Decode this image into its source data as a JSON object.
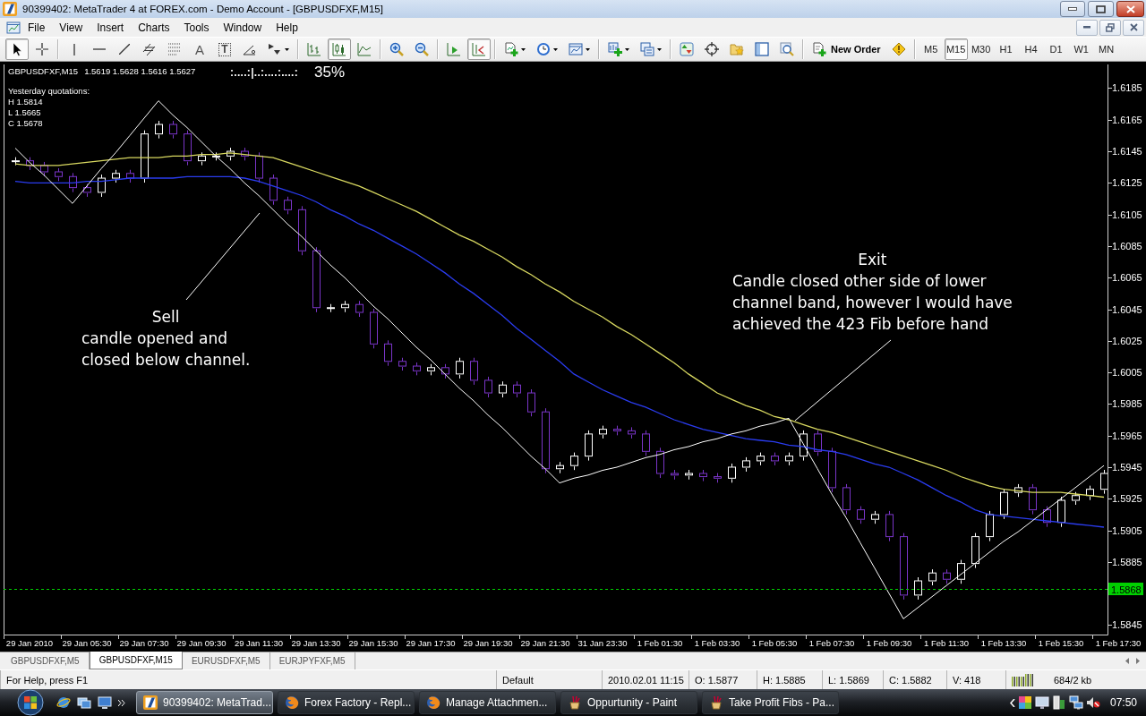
{
  "window": {
    "title": "90399402: MetaTrader 4 at FOREX.com - Demo Account - [GBPUSDFXF,M15]"
  },
  "menu": [
    "File",
    "View",
    "Insert",
    "Charts",
    "Tools",
    "Window",
    "Help"
  ],
  "toolbar": {
    "groups": [
      [
        {
          "kind": "icon",
          "pressed": true
        },
        {
          "kind": "icon",
          "pressed": false
        }
      ],
      [
        {
          "kind": "icon",
          "pressed": false
        },
        {
          "kind": "icon",
          "pressed": false
        },
        {
          "kind": "icon",
          "pressed": false
        },
        {
          "kind": "icon",
          "pressed": false
        },
        {
          "kind": "icon",
          "pressed": false
        },
        {
          "kind": "glyph",
          "label": "A",
          "pressed": false
        },
        {
          "kind": "glyph",
          "label": "T",
          "pressed": false
        },
        {
          "kind": "icon",
          "pressed": false
        },
        {
          "kind": "dropdown",
          "pressed": false
        }
      ],
      [
        {
          "kind": "icon",
          "pressed": false
        },
        {
          "kind": "icon",
          "pressed": true
        },
        {
          "kind": "icon",
          "pressed": false
        }
      ],
      [
        {
          "kind": "icon",
          "pressed": false
        },
        {
          "kind": "icon",
          "pressed": false
        }
      ],
      [
        {
          "kind": "icon",
          "pressed": false
        },
        {
          "kind": "icon",
          "pressed": true
        }
      ],
      [
        {
          "kind": "dropdown",
          "pressed": false
        },
        {
          "kind": "dropdown",
          "pressed": false
        },
        {
          "kind": "dropdown",
          "pressed": false
        }
      ],
      [
        {
          "kind": "dropdown",
          "pressed": false
        },
        {
          "kind": "dropdown",
          "pressed": false
        }
      ],
      [
        {
          "kind": "icon",
          "pressed": false
        },
        {
          "kind": "icon",
          "pressed": false
        },
        {
          "kind": "icon",
          "pressed": false
        },
        {
          "kind": "icon",
          "pressed": false
        },
        {
          "kind": "icon",
          "pressed": false
        }
      ],
      [
        {
          "kind": "labeled",
          "label": "New Order",
          "pressed": false
        },
        {
          "kind": "icon",
          "pressed": false
        }
      ]
    ],
    "periods": [
      {
        "label": "M5",
        "selected": false
      },
      {
        "label": "M15",
        "selected": true
      },
      {
        "label": "M30",
        "selected": false
      },
      {
        "label": "H1",
        "selected": false
      },
      {
        "label": "H4",
        "selected": false
      },
      {
        "label": "D1",
        "selected": false
      },
      {
        "label": "W1",
        "selected": false
      },
      {
        "label": "MN",
        "selected": false
      }
    ]
  },
  "chart": {
    "symbol": "GBPUSDFXF,M15",
    "ohlc": "1.5619 1.5628 1.5616 1.5627",
    "timer": {
      "text": ":....:|..:....:....:",
      "percent": "35%"
    },
    "yesterday": {
      "title": "Yesterday quotations:",
      "lines": [
        "H 1.5814",
        "L 1.5665",
        "C 1.5678"
      ]
    },
    "chart_data": {
      "type": "line",
      "categories": [
        null,
        "29 Jan 2010",
        null,
        null,
        null,
        "29 Jan 05:30",
        null,
        null,
        null,
        "29 Jan 07:30",
        null,
        null,
        null,
        "29 Jan 09:30",
        null,
        null,
        null,
        "29 Jan 11:30",
        null,
        null,
        null,
        "29 Jan 13:30",
        null,
        null,
        null,
        "29 Jan 15:30",
        null,
        null,
        null,
        "29 Jan 17:30",
        null,
        null,
        null,
        "29 Jan 19:30",
        null,
        null,
        null,
        "29 Jan 21:30",
        null,
        null,
        null,
        "31 Jan 23:30",
        null,
        null,
        null,
        "1 Feb 01:30",
        null,
        null,
        null,
        "1 Feb 03:30",
        null,
        null,
        null,
        "1 Feb 05:30",
        null,
        null,
        null,
        "1 Feb 07:30",
        null,
        null,
        null,
        "1 Feb 09:30",
        null,
        null,
        null,
        "1 Feb 11:30",
        null,
        null,
        null,
        "1 Feb 13:30",
        null,
        null,
        null,
        "1 Feb 15:30",
        null,
        null,
        null,
        "1 Feb 17:30"
      ],
      "ylim": [
        1.5839,
        1.62
      ],
      "yticks": [
        1.5845,
        1.5885,
        1.5905,
        1.5925,
        1.5945,
        1.5965,
        1.5985,
        1.6005,
        1.6025,
        1.6045,
        1.6065,
        1.6085,
        1.6105,
        1.6125,
        1.6145,
        1.6165,
        1.6185
      ],
      "series": [
        {
          "color": "#d8d860",
          "values": [
            1.6137,
            1.6136,
            1.6136,
            1.6136,
            1.6137,
            1.6138,
            1.6139,
            1.614,
            1.6141,
            1.6141,
            1.6141,
            1.6142,
            1.6142,
            1.6143,
            1.6143,
            1.6144,
            1.6143,
            1.6142,
            1.6141,
            1.6138,
            1.6135,
            1.6132,
            1.6129,
            1.6126,
            1.6123,
            1.6119,
            1.6115,
            1.6111,
            1.6107,
            1.6102,
            1.6097,
            1.6092,
            1.6088,
            1.6083,
            1.6078,
            1.6072,
            1.6067,
            1.6061,
            1.6056,
            1.605,
            1.6045,
            1.604,
            1.6034,
            1.6029,
            1.6023,
            1.6017,
            1.6011,
            1.6004,
            1.5998,
            1.5992,
            1.5988,
            1.5984,
            1.5981,
            1.5977,
            1.5975,
            1.5972,
            1.5969,
            1.5967,
            1.5964,
            1.5961,
            1.5958,
            1.5955,
            1.5952,
            1.5949,
            1.5946,
            1.5943,
            1.5939,
            1.5936,
            1.5933,
            1.5931,
            1.593,
            1.5929,
            1.5929,
            1.5929,
            1.5928,
            1.5927,
            1.5926,
            null
          ]
        },
        {
          "color": "#2a3cf0",
          "values": [
            1.6126,
            1.6125,
            1.6125,
            1.6125,
            1.6125,
            1.6126,
            1.6126,
            1.6127,
            1.6128,
            1.6128,
            1.6128,
            1.6128,
            1.6129,
            1.6129,
            1.6129,
            1.6129,
            1.6128,
            1.6126,
            1.6123,
            1.612,
            1.6117,
            1.6113,
            1.6108,
            1.6104,
            1.6099,
            1.6095,
            1.609,
            1.6085,
            1.608,
            1.6074,
            1.6068,
            1.6061,
            1.6055,
            1.6048,
            1.6041,
            1.6033,
            1.6026,
            1.6019,
            1.6012,
            1.6004,
            1.5999,
            1.5994,
            1.599,
            1.5986,
            1.5983,
            1.5979,
            1.5975,
            1.5972,
            1.5969,
            1.5967,
            1.5965,
            1.5963,
            1.5962,
            1.5961,
            1.5959,
            1.5958,
            1.5956,
            1.5955,
            1.5953,
            1.595,
            1.5947,
            1.5945,
            1.5941,
            1.5937,
            1.5932,
            1.5927,
            1.5923,
            1.5918,
            1.5915,
            1.5914,
            1.5913,
            1.5912,
            1.5911,
            1.591,
            1.5909,
            1.5908,
            1.5907,
            null
          ]
        },
        {
          "color": "#ffffff",
          "values": [
            1.6147,
            1.6138,
            1.613,
            1.6121,
            1.6112,
            1.6123,
            1.6134,
            1.6144,
            1.6155,
            1.6166,
            1.6177,
            1.6168,
            1.616,
            1.6151,
            1.6142,
            1.6134,
            1.6125,
            1.6117,
            1.6108,
            1.6099,
            1.6091,
            1.6082,
            1.6073,
            1.6065,
            1.6056,
            1.6047,
            1.6039,
            1.603,
            1.6021,
            1.6013,
            1.6004,
            1.5995,
            1.5987,
            1.5978,
            1.597,
            1.5961,
            1.5952,
            1.5944,
            1.5935,
            1.5938,
            1.594,
            1.5943,
            1.5945,
            1.5948,
            1.5951,
            1.5953,
            1.5956,
            1.5958,
            1.5961,
            1.5963,
            1.5966,
            1.5968,
            1.5971,
            1.5973,
            1.5976,
            1.596,
            1.5944,
            1.5928,
            1.5913,
            1.5897,
            1.5881,
            1.5865,
            1.5849,
            1.5856,
            1.5863,
            1.587,
            1.5877,
            1.5884,
            1.5891,
            1.5898,
            1.5904,
            1.5911,
            1.5918,
            1.5925,
            1.5932,
            1.5939,
            1.5946,
            null
          ]
        }
      ],
      "annotations": [
        "Sell\ncandle opened and\nclosed below channel.",
        "Exit\nCandle closed other side of lower\nchannel band, however I would have\nachieved the 423 Fib before hand"
      ],
      "ref_lines": [
        {
          "axis": "y",
          "value": 1.5868,
          "label": "1.5868",
          "color": "#00d000"
        }
      ]
    }
  },
  "chart_tabs": [
    {
      "label": "GBPUSDFXF,M5",
      "selected": false
    },
    {
      "label": "GBPUSDFXF,M15",
      "selected": true
    },
    {
      "label": "EURUSDFXF,M5",
      "selected": false
    },
    {
      "label": "EURJPYFXF,M5",
      "selected": false
    }
  ],
  "status_bar": {
    "help": "For Help, press F1",
    "profile": "Default",
    "time": "2010.02.01 11:15",
    "open": "O: 1.5877",
    "high": "H: 1.5885",
    "low": "L: 1.5869",
    "close": "C: 1.5882",
    "volume": "V: 418",
    "traffic": "684/2 kb"
  },
  "taskbar": {
    "tasks": [
      {
        "kind": "app",
        "label": "90399402: MetaTrad...",
        "selected": true
      },
      {
        "kind": "browser",
        "label": "Forex Factory - Repl...",
        "selected": false
      },
      {
        "kind": "browser",
        "label": "Manage Attachmen...",
        "selected": false
      },
      {
        "kind": "paint",
        "label": "Oppurtunity - Paint",
        "selected": false
      },
      {
        "kind": "paint",
        "label": "Take Profit Fibs - Pa...",
        "selected": false
      }
    ],
    "clock": "07:50"
  }
}
